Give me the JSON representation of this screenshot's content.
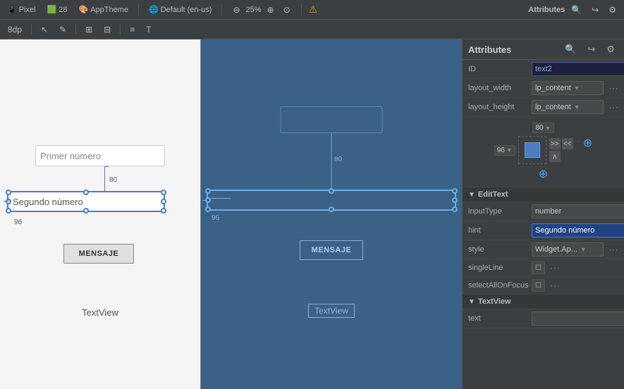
{
  "topbar": {
    "device": "Pixel",
    "api": "28",
    "theme": "AppTheme",
    "locale": "Default (en-us)",
    "zoom": "25%",
    "title": "Attributes"
  },
  "toolbar": {
    "margin": "8dp",
    "icons": [
      "pointer",
      "hand",
      "align",
      "distribute",
      "text"
    ]
  },
  "whitepanel": {
    "edittext1_hint": "Primer número",
    "edittext2_hint": "Segundo número",
    "dim_80": "80",
    "dim_96": "96",
    "button_label": "MENSAJE",
    "textview_label": "TextView"
  },
  "bluepanel": {
    "dim_80": "80",
    "dim_96": "96",
    "button_label": "MENSAJE",
    "textview_label": "TextView"
  },
  "attributes": {
    "header": "Attributes",
    "id_label": "ID",
    "id_value": "text2",
    "layout_width_label": "layout_width",
    "layout_width_value": "lp_content",
    "layout_height_label": "layout_height",
    "layout_height_value": "lp_content",
    "constraint_top": "80",
    "constraint_left": "96",
    "edittext_section": "EditText",
    "inputType_label": "inputType",
    "inputType_value": "number",
    "hint_label": "hint",
    "hint_value": "Segundo número",
    "style_label": "style",
    "style_value": "Widget.Ap...",
    "singleLine_label": "singleLine",
    "selectAllOnFocus_label": "selectAllOnFocus",
    "textview_section": "TextView",
    "text_label": "text"
  }
}
